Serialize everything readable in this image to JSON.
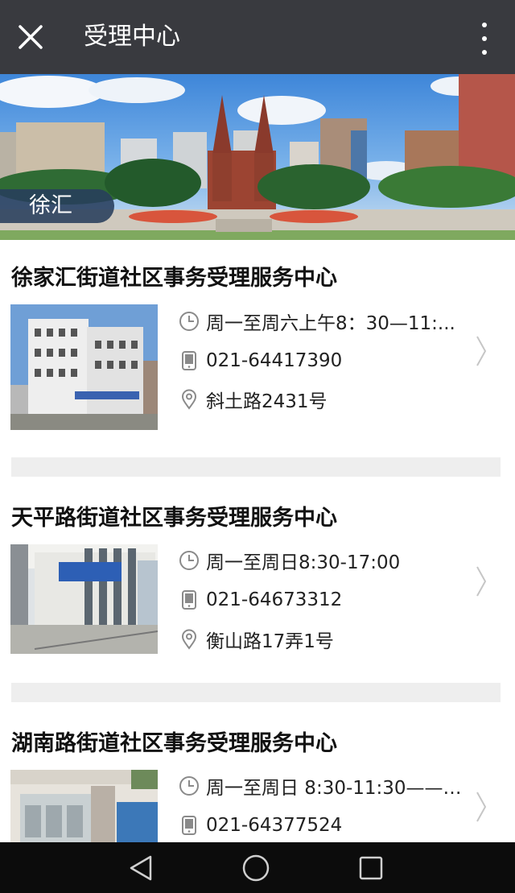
{
  "header": {
    "title": "受理中心",
    "close_icon": "close-icon",
    "more_icon": "more-vertical-icon"
  },
  "banner": {
    "tag": "徐汇"
  },
  "centers": [
    {
      "name": "徐家汇街道社区事务受理服务中心",
      "hours": "周一至周六上午8：30—11:...",
      "phone": "021-64417390",
      "address": "斜土路2431号"
    },
    {
      "name": "天平路街道社区事务受理服务中心",
      "hours": "周一至周日8:30-17:00",
      "phone": "021-64673312",
      "address": "衡山路17弄1号"
    },
    {
      "name": "湖南路街道社区事务受理服务中心",
      "hours": "周一至周日 8:30-11:30——1...",
      "phone": "021-64377524",
      "address": ""
    }
  ],
  "icons": {
    "clock": "clock-icon",
    "phone": "phone-icon",
    "location": "location-pin-icon",
    "arrow": "chevron-right-icon"
  },
  "colors": {
    "titlebar": "#393a3f",
    "navbar": "#0c0c0c",
    "separator": "#eeeeee",
    "icon_gray": "#8a8a8a"
  },
  "navbar": {
    "back": "back-icon",
    "home": "home-icon",
    "recents": "recents-icon"
  }
}
